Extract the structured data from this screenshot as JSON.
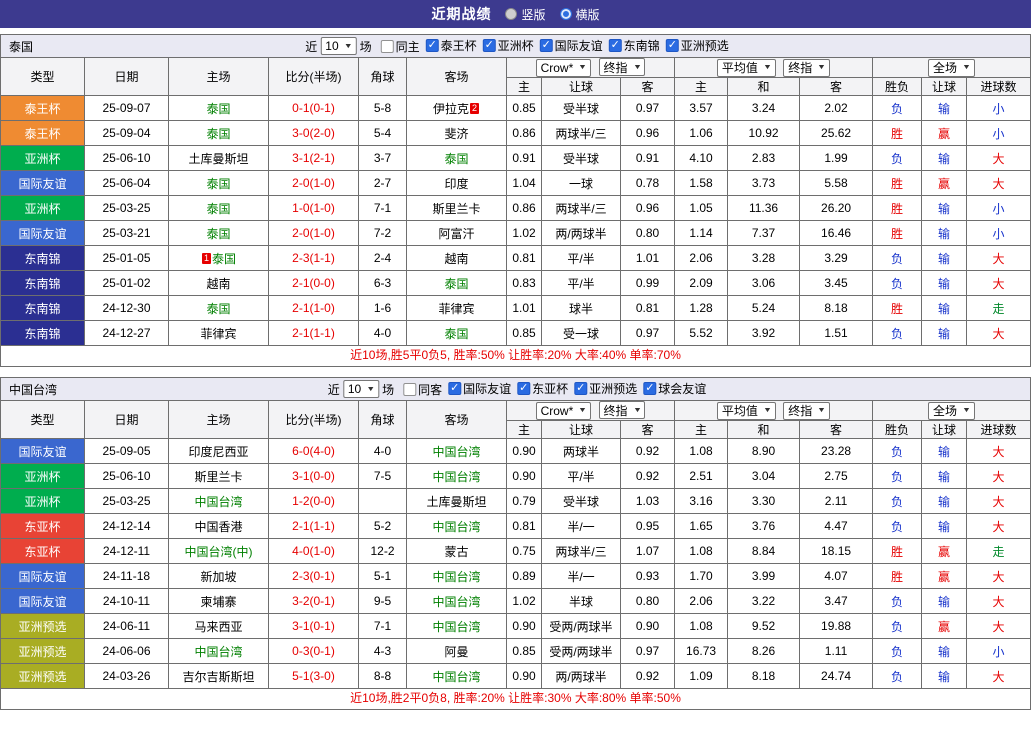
{
  "title_bar": {
    "title": "近期战绩",
    "options": [
      {
        "label": "竖版",
        "selected": false
      },
      {
        "label": "横版",
        "selected": true
      }
    ]
  },
  "filter_labels": {
    "near": "近",
    "games": "场"
  },
  "table_header": {
    "main": [
      "类型",
      "日期",
      "主场",
      "比分(半场)",
      "角球",
      "客场"
    ],
    "odds_select": "Crow*",
    "final_button": "终指",
    "avg_select": "平均值",
    "scope_select": "全场",
    "sub": [
      "主",
      "让球",
      "客",
      "主",
      "和",
      "客",
      "胜负",
      "让球",
      "进球数"
    ]
  },
  "colors": {
    "type_colors": {
      "泰王杯": "#ef8b32",
      "亚洲杯": "#00ad4e",
      "国际友谊": "#3a67cf",
      "东南锦": "#2b2f92",
      "东亚杯": "#e84335",
      "亚洲预选": "#a9ad23"
    },
    "result_colors": {
      "胜": "#e60000",
      "负": "#1733cc",
      "赢": "#e60000",
      "输": "#1733cc",
      "大": "#e60000",
      "小": "#1733cc",
      "走": "#00882a"
    },
    "score_color": "#e60000",
    "team_highlight": "#008000",
    "summary_color": "#e60000"
  },
  "sections": [
    {
      "team": "泰国",
      "filter": {
        "count": "10",
        "same": "同主",
        "same_checked": false,
        "competitions": [
          "泰王杯",
          "亚洲杯",
          "国际友谊",
          "东南锦",
          "亚洲预选"
        ]
      },
      "rows": [
        {
          "type": "泰王杯",
          "date": "25-09-07",
          "home": "泰国",
          "home_hl": true,
          "score": "0-1(0-1)",
          "corner": "5-8",
          "away": "伊拉克",
          "away_mark": "2",
          "odds": [
            "0.85",
            "受半球",
            "0.97",
            "3.57",
            "3.24",
            "2.02"
          ],
          "results": [
            "负",
            "输",
            "小"
          ]
        },
        {
          "type": "泰王杯",
          "date": "25-09-04",
          "home": "泰国",
          "home_hl": true,
          "score": "3-0(2-0)",
          "corner": "5-4",
          "away": "斐济",
          "odds": [
            "0.86",
            "两球半/三",
            "0.96",
            "1.06",
            "10.92",
            "25.62"
          ],
          "results": [
            "胜",
            "赢",
            "小"
          ]
        },
        {
          "type": "亚洲杯",
          "date": "25-06-10",
          "home": "土库曼斯坦",
          "score": "3-1(2-1)",
          "corner": "3-7",
          "away": "泰国",
          "away_hl": true,
          "odds": [
            "0.91",
            "受半球",
            "0.91",
            "4.10",
            "2.83",
            "1.99"
          ],
          "results": [
            "负",
            "输",
            "大"
          ]
        },
        {
          "type": "国际友谊",
          "date": "25-06-04",
          "home": "泰国",
          "home_hl": true,
          "score": "2-0(1-0)",
          "corner": "2-7",
          "away": "印度",
          "odds": [
            "1.04",
            "一球",
            "0.78",
            "1.58",
            "3.73",
            "5.58"
          ],
          "results": [
            "胜",
            "赢",
            "大"
          ]
        },
        {
          "type": "亚洲杯",
          "date": "25-03-25",
          "home": "泰国",
          "home_hl": true,
          "score": "1-0(1-0)",
          "corner": "7-1",
          "away": "斯里兰卡",
          "odds": [
            "0.86",
            "两球半/三",
            "0.96",
            "1.05",
            "11.36",
            "26.20"
          ],
          "results": [
            "胜",
            "输",
            "小"
          ]
        },
        {
          "type": "国际友谊",
          "date": "25-03-21",
          "home": "泰国",
          "home_hl": true,
          "score": "2-0(1-0)",
          "corner": "7-2",
          "away": "阿富汗",
          "odds": [
            "1.02",
            "两/两球半",
            "0.80",
            "1.14",
            "7.37",
            "16.46"
          ],
          "results": [
            "胜",
            "输",
            "小"
          ]
        },
        {
          "type": "东南锦",
          "date": "25-01-05",
          "home": "泰国",
          "home_hl": true,
          "home_mark": "1",
          "score": "2-3(1-1)",
          "corner": "2-4",
          "away": "越南",
          "odds": [
            "0.81",
            "平/半",
            "1.01",
            "2.06",
            "3.28",
            "3.29"
          ],
          "results": [
            "负",
            "输",
            "大"
          ]
        },
        {
          "type": "东南锦",
          "date": "25-01-02",
          "home": "越南",
          "score": "2-1(0-0)",
          "corner": "6-3",
          "away": "泰国",
          "away_hl": true,
          "odds": [
            "0.83",
            "平/半",
            "0.99",
            "2.09",
            "3.06",
            "3.45"
          ],
          "results": [
            "负",
            "输",
            "大"
          ]
        },
        {
          "type": "东南锦",
          "date": "24-12-30",
          "home": "泰国",
          "home_hl": true,
          "score": "2-1(1-0)",
          "corner": "1-6",
          "away": "菲律宾",
          "odds": [
            "1.01",
            "球半",
            "0.81",
            "1.28",
            "5.24",
            "8.18"
          ],
          "results": [
            "胜",
            "输",
            "走"
          ]
        },
        {
          "type": "东南锦",
          "date": "24-12-27",
          "home": "菲律宾",
          "score": "2-1(1-1)",
          "corner": "4-0",
          "away": "泰国",
          "away_hl": true,
          "odds": [
            "0.85",
            "受一球",
            "0.97",
            "5.52",
            "3.92",
            "1.51"
          ],
          "results": [
            "负",
            "输",
            "大"
          ]
        }
      ],
      "summary": "近10场,胜5平0负5, 胜率:50% 让胜率:20% 大率:40% 单率:70%"
    },
    {
      "team": "中国台湾",
      "filter": {
        "count": "10",
        "same": "同客",
        "same_checked": false,
        "competitions": [
          "国际友谊",
          "东亚杯",
          "亚洲预选",
          "球会友谊"
        ]
      },
      "rows": [
        {
          "type": "国际友谊",
          "date": "25-09-05",
          "home": "印度尼西亚",
          "score": "6-0(4-0)",
          "corner": "4-0",
          "away": "中国台湾",
          "away_hl": true,
          "odds": [
            "0.90",
            "两球半",
            "0.92",
            "1.08",
            "8.90",
            "23.28"
          ],
          "results": [
            "负",
            "输",
            "大"
          ]
        },
        {
          "type": "亚洲杯",
          "date": "25-06-10",
          "home": "斯里兰卡",
          "score": "3-1(0-0)",
          "corner": "7-5",
          "away": "中国台湾",
          "away_hl": true,
          "odds": [
            "0.90",
            "平/半",
            "0.92",
            "2.51",
            "3.04",
            "2.75"
          ],
          "results": [
            "负",
            "输",
            "大"
          ]
        },
        {
          "type": "亚洲杯",
          "date": "25-03-25",
          "home": "中国台湾",
          "home_hl": true,
          "score": "1-2(0-0)",
          "corner": "",
          "away": "土库曼斯坦",
          "odds": [
            "0.79",
            "受半球",
            "1.03",
            "3.16",
            "3.30",
            "2.11"
          ],
          "results": [
            "负",
            "输",
            "大"
          ]
        },
        {
          "type": "东亚杯",
          "date": "24-12-14",
          "home": "中国香港",
          "score": "2-1(1-1)",
          "corner": "5-2",
          "away": "中国台湾",
          "away_hl": true,
          "odds": [
            "0.81",
            "半/一",
            "0.95",
            "1.65",
            "3.76",
            "4.47"
          ],
          "results": [
            "负",
            "输",
            "大"
          ]
        },
        {
          "type": "东亚杯",
          "date": "24-12-11",
          "home": "中国台湾(中)",
          "home_hl": true,
          "score": "4-0(1-0)",
          "corner": "12-2",
          "away": "蒙古",
          "odds": [
            "0.75",
            "两球半/三",
            "1.07",
            "1.08",
            "8.84",
            "18.15"
          ],
          "results": [
            "胜",
            "赢",
            "走"
          ]
        },
        {
          "type": "国际友谊",
          "date": "24-11-18",
          "home": "新加坡",
          "score": "2-3(0-1)",
          "corner": "5-1",
          "away": "中国台湾",
          "away_hl": true,
          "odds": [
            "0.89",
            "半/一",
            "0.93",
            "1.70",
            "3.99",
            "4.07"
          ],
          "results": [
            "胜",
            "赢",
            "大"
          ]
        },
        {
          "type": "国际友谊",
          "date": "24-10-11",
          "home": "柬埔寨",
          "score": "3-2(0-1)",
          "corner": "9-5",
          "away": "中国台湾",
          "away_hl": true,
          "odds": [
            "1.02",
            "半球",
            "0.80",
            "2.06",
            "3.22",
            "3.47"
          ],
          "results": [
            "负",
            "输",
            "大"
          ]
        },
        {
          "type": "亚洲预选",
          "date": "24-06-11",
          "home": "马来西亚",
          "score": "3-1(0-1)",
          "corner": "7-1",
          "away": "中国台湾",
          "away_hl": true,
          "odds": [
            "0.90",
            "受两/两球半",
            "0.90",
            "1.08",
            "9.52",
            "19.88"
          ],
          "results": [
            "负",
            "赢",
            "大"
          ]
        },
        {
          "type": "亚洲预选",
          "date": "24-06-06",
          "home": "中国台湾",
          "home_hl": true,
          "score": "0-3(0-1)",
          "corner": "4-3",
          "away": "阿曼",
          "odds": [
            "0.85",
            "受两/两球半",
            "0.97",
            "16.73",
            "8.26",
            "1.11"
          ],
          "results": [
            "负",
            "输",
            "小"
          ]
        },
        {
          "type": "亚洲预选",
          "date": "24-03-26",
          "home": "吉尔吉斯斯坦",
          "score": "5-1(3-0)",
          "corner": "8-8",
          "away": "中国台湾",
          "away_hl": true,
          "odds": [
            "0.90",
            "两/两球半",
            "0.92",
            "1.09",
            "8.18",
            "24.74"
          ],
          "results": [
            "负",
            "输",
            "大"
          ]
        }
      ],
      "summary": "近10场,胜2平0负8, 胜率:20% 让胜率:30% 大率:80% 单率:50%"
    }
  ]
}
